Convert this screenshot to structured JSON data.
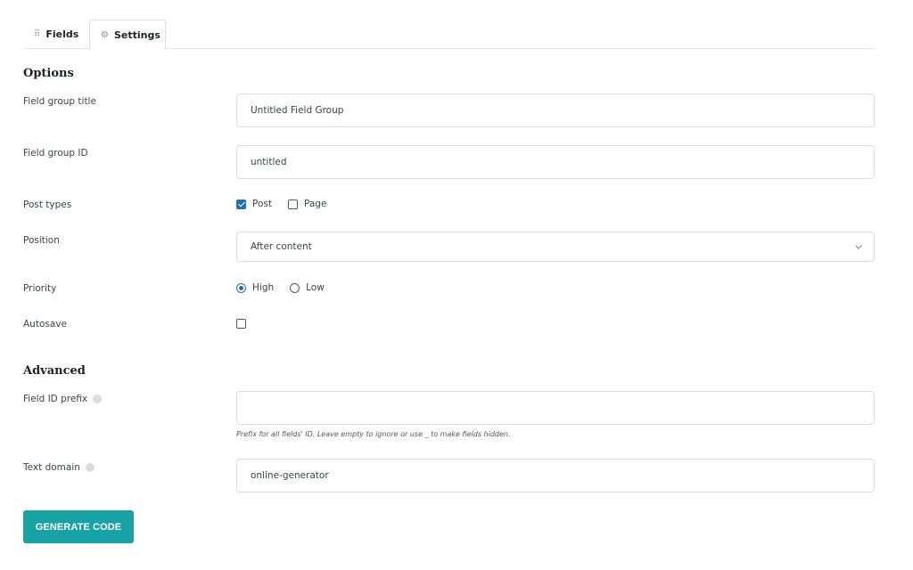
{
  "tabs": [
    {
      "label": "Fields",
      "icon": "grid-dots-icon"
    },
    {
      "label": "Settings",
      "icon": "gear-icon",
      "active": true
    }
  ],
  "options": {
    "title": "Options",
    "field_group_title": {
      "label": "Field group title",
      "value": "Untitled Field Group"
    },
    "field_group_id": {
      "label": "Field group ID",
      "value": "untitled"
    },
    "post_types": {
      "label": "Post types",
      "choices": [
        {
          "label": "Post",
          "checked": true
        },
        {
          "label": "Page",
          "checked": false
        }
      ]
    },
    "position": {
      "label": "Position",
      "value": "After content"
    },
    "priority": {
      "label": "Priority",
      "choices": [
        {
          "label": "High",
          "checked": true
        },
        {
          "label": "Low",
          "checked": false
        }
      ]
    },
    "autosave": {
      "label": "Autosave",
      "checked": false
    }
  },
  "advanced": {
    "title": "Advanced",
    "field_id_prefix": {
      "label": "Field ID prefix",
      "value": "",
      "help": "Prefix for all fields' ID. Leave empty to ignore or use _ to make fields hidden."
    },
    "text_domain": {
      "label": "Text domain",
      "value": "online-generator"
    }
  },
  "actions": {
    "generate_label": "GENERATE CODE"
  },
  "colors": {
    "accent": "#17a2a6",
    "checkbox": "#2271b1"
  }
}
